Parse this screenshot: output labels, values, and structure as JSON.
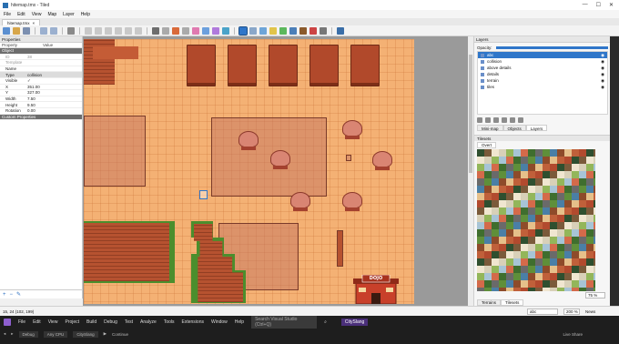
{
  "window": {
    "title": "hitemap.tmx - Tiled",
    "controls": [
      "—",
      "☐",
      "✕"
    ]
  },
  "menu": [
    "File",
    "Edit",
    "View",
    "Map",
    "Layer",
    "Help"
  ],
  "doc_tab": {
    "label": "hitemap.tmx",
    "close": "×"
  },
  "properties_panel": {
    "title": "Properties",
    "col_property": "Property",
    "col_value": "Value",
    "section_object": "Object",
    "rows": [
      {
        "key": "ID",
        "value": "38",
        "dim": true
      },
      {
        "key": "Template",
        "value": "",
        "dim": true
      },
      {
        "key": "Name",
        "value": ""
      },
      {
        "key": "Type",
        "value": "collision",
        "highlight": true
      },
      {
        "key": "Visible",
        "value": "✓"
      },
      {
        "key": "X",
        "value": "351.00"
      },
      {
        "key": "Y",
        "value": "327.00"
      },
      {
        "key": "Width",
        "value": "7.50"
      },
      {
        "key": "Height",
        "value": "9.50"
      },
      {
        "key": "Rotation",
        "value": "0.00"
      }
    ],
    "section_custom": "Custom Properties",
    "footer_icons": [
      "+",
      "−",
      "✎"
    ]
  },
  "layers_panel": {
    "title": "Layers",
    "opacity_label": "Opacity:",
    "opacity": 1.0,
    "layers": [
      {
        "name": "abc",
        "selected": true
      },
      {
        "name": "collision",
        "selected": false
      },
      {
        "name": "above details",
        "selected": false
      },
      {
        "name": "details",
        "selected": false
      },
      {
        "name": "terrain",
        "selected": false
      },
      {
        "name": "tiles",
        "selected": false
      }
    ],
    "tabs": [
      "Mini-map",
      "Objects",
      "Layers"
    ],
    "active_tab": "Layers"
  },
  "tilesets_panel": {
    "title": "Tilesets",
    "tab": "Overt",
    "zoom": "75 %",
    "bottom_tabs": [
      "Terrains",
      "Tilesets"
    ],
    "active_bottom_tab": "Tilesets"
  },
  "map": {
    "sign_text": "DOJO"
  },
  "statusbar": {
    "coords": "15, 24 (102, 199)",
    "layer_combo": "abc",
    "zoom": "200 %",
    "news": "News"
  },
  "vs": {
    "menu": [
      "File",
      "Edit",
      "View",
      "Project",
      "Build",
      "Debug",
      "Test",
      "Analyze",
      "Tools",
      "Extensions",
      "Window",
      "Help"
    ],
    "search_placeholder": "Search Visual Studio (Ctrl+Q)",
    "project": "CitySlang",
    "toolbar": [
      "Debug",
      "Any CPU",
      "CitySlang",
      "Continue"
    ],
    "live_share": "Live Share"
  },
  "colors": {
    "floor": "#f4b174",
    "roof": "#b1492b",
    "region": "#be6e5f",
    "grass": "#4b8e2d",
    "selection": "#2f76c9"
  }
}
